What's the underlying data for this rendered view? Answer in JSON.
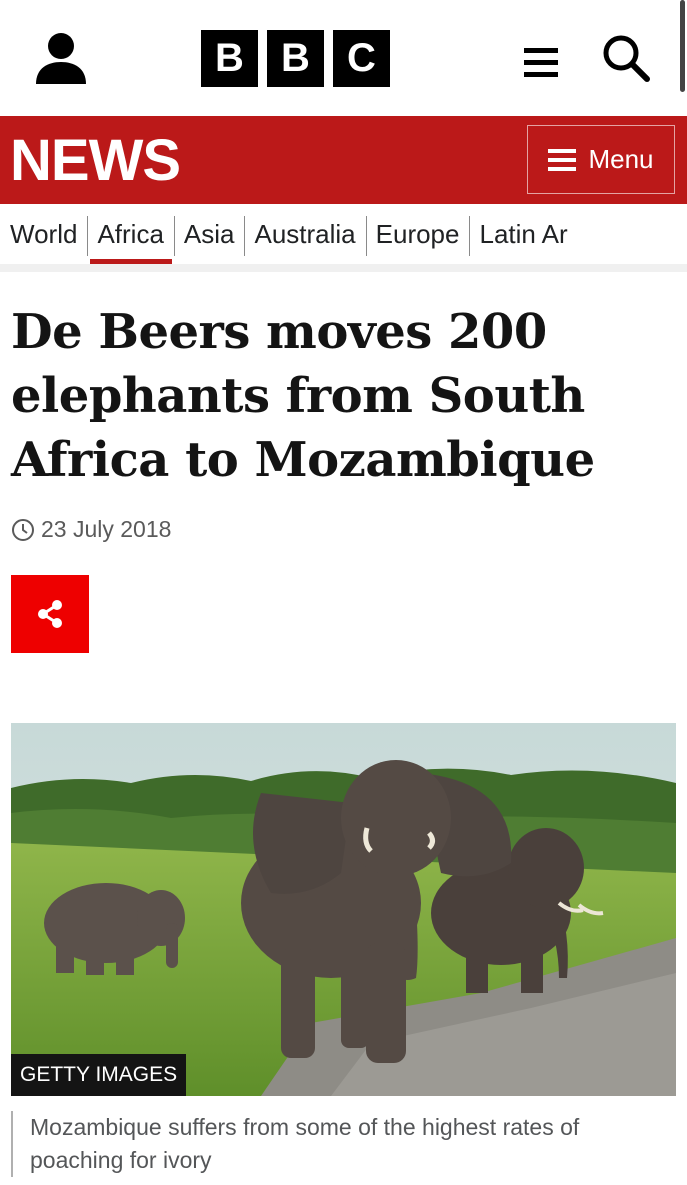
{
  "header": {
    "logo_letters": [
      "B",
      "B",
      "C"
    ],
    "account_icon": "account-icon",
    "menu_icon": "hamburger-icon",
    "search_icon": "search-icon"
  },
  "banner": {
    "title": "NEWS",
    "menu_label": "Menu",
    "color": "#bb1919"
  },
  "nav": {
    "items": [
      "World",
      "Africa",
      "Asia",
      "Australia",
      "Europe",
      "Latin Ar"
    ],
    "active": "Africa"
  },
  "article": {
    "headline": "De Beers moves 200 elephants from South Africa to Mozambique",
    "date": "23 July 2018",
    "share_icon": "share-icon",
    "share_color": "#ee0000"
  },
  "image": {
    "credit": "GETTY IMAGES",
    "caption": "Mozambique suffers from some of the highest rates of poaching for ivory"
  }
}
